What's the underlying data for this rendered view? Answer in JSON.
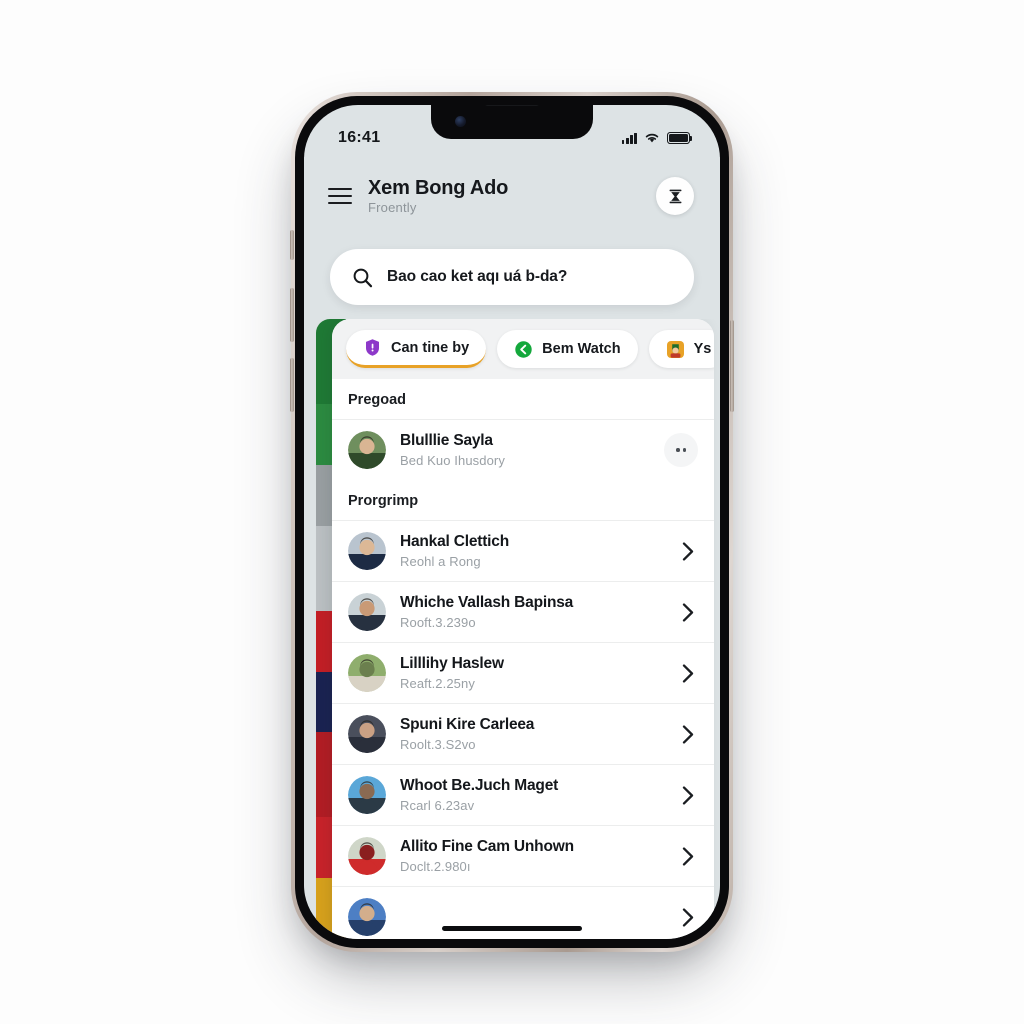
{
  "status_bar": {
    "time": "16:41",
    "signal_icon": "signal-bars-icon",
    "wifi_icon": "wifi-icon",
    "battery_icon": "battery-icon"
  },
  "header": {
    "menu_icon": "hamburger-menu-icon",
    "title": "Xem Bong Ado",
    "subtitle": "Froently",
    "action_icon": "inbox-download-icon"
  },
  "search": {
    "icon": "search-icon",
    "text": "Bao cao ket aqı uá b-da?"
  },
  "chips": [
    {
      "label": "Can tine by",
      "icon": "shield-badge-icon",
      "icon_bg": "#8d38c9",
      "active": true
    },
    {
      "label": "Bem Watch",
      "icon": "back-arrow-circle-icon",
      "icon_bg": "#14a83c",
      "active": false
    },
    {
      "label": "Ys",
      "icon": "person-avatar-icon",
      "icon_bg": "#e8a227",
      "active": false
    }
  ],
  "sections": [
    {
      "heading": "Pregoad",
      "rows": [
        {
          "title": "Blulllie Sayla",
          "subtitle": "Bed Kuo Ihusdory",
          "trailing": "more-dots",
          "avatar": "avatar-1"
        }
      ]
    },
    {
      "heading": "Prorgrimp",
      "rows": [
        {
          "title": "Hankal Clettich",
          "subtitle": "Reohl a Rong",
          "trailing": "chevron",
          "avatar": "avatar-2"
        },
        {
          "title": "Whiche Vallash Bapinsa",
          "subtitle": "Rooft.3.239o",
          "trailing": "chevron",
          "avatar": "avatar-3"
        },
        {
          "title": "Lilllihy Haslew",
          "subtitle": "Reaft.2.25ny",
          "trailing": "chevron",
          "avatar": "avatar-4"
        },
        {
          "title": "Spuni Kire Carleea",
          "subtitle": "Roolt.3.S2vo",
          "trailing": "chevron",
          "avatar": "avatar-5"
        },
        {
          "title": "Whoot Be.Juch Maget",
          "subtitle": "Rcarl 6.23av",
          "trailing": "chevron",
          "avatar": "avatar-6"
        },
        {
          "title": "Allito Fine Cam Unhown",
          "subtitle": "Doclt.2.980ı",
          "trailing": "chevron",
          "avatar": "avatar-7"
        },
        {
          "title": "",
          "subtitle": "",
          "trailing": "chevron",
          "avatar": "avatar-8"
        }
      ]
    }
  ],
  "peek_strip_colors": [
    "#1f7a35",
    "#2c8c41",
    "#9aa0a3",
    "#bcc1c4",
    "#c41f26",
    "#1a2352",
    "#b31d24",
    "#c9232a",
    "#d8a21c"
  ],
  "colors": {
    "screen_bg": "#dde3e5",
    "card_bg": "#ffffff",
    "chip_strip_bg": "#f1f2f3",
    "accent": "#e8a227"
  }
}
